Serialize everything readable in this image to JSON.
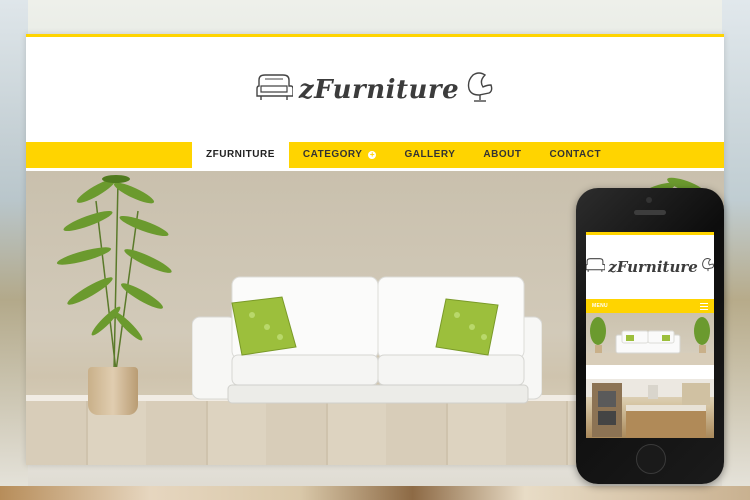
{
  "site": {
    "logo_text": "zFurniture",
    "nav": [
      {
        "label": "ZFURNITURE",
        "active": true
      },
      {
        "label": "CATEGORY",
        "has_submenu": true
      },
      {
        "label": "GALLERY"
      },
      {
        "label": "ABOUT"
      },
      {
        "label": "CONTACT"
      }
    ]
  },
  "mobile": {
    "logo_text": "zFurniture",
    "menu_label": "MENU"
  },
  "colors": {
    "accent": "#ffd400",
    "logo": "#3c3c3c",
    "phone_body": "#111111"
  },
  "icons": [
    "armchair-icon",
    "egg-chair-icon",
    "plus-icon",
    "hamburger-menu-icon"
  ]
}
